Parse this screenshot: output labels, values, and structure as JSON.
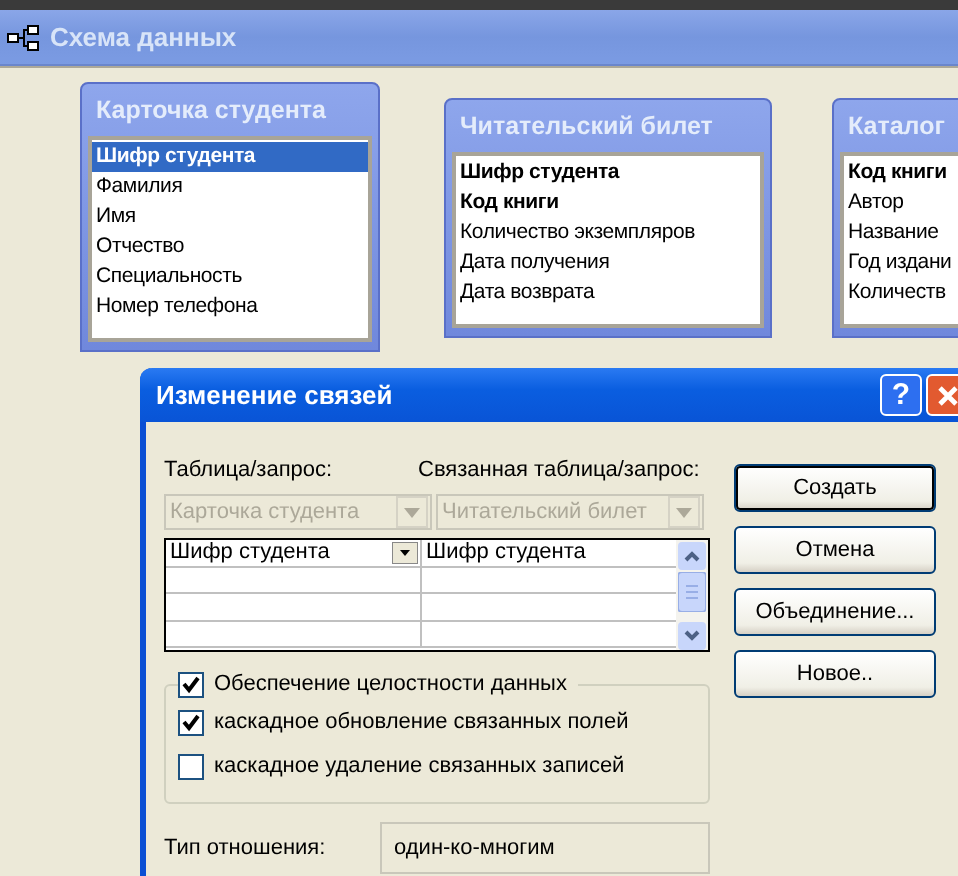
{
  "window": {
    "title": "Схема данных"
  },
  "tables": [
    {
      "title": "Карточка студента",
      "fields": [
        {
          "name": "Шифр студента",
          "key": true,
          "selected": true
        },
        {
          "name": "Фамилия",
          "key": false,
          "selected": false
        },
        {
          "name": "Имя",
          "key": false,
          "selected": false
        },
        {
          "name": "Отчество",
          "key": false,
          "selected": false
        },
        {
          "name": "Специальность",
          "key": false,
          "selected": false
        },
        {
          "name": "Номер телефона",
          "key": false,
          "selected": false
        }
      ]
    },
    {
      "title": "Читательский билет",
      "fields": [
        {
          "name": "Шифр студента",
          "key": true,
          "selected": false
        },
        {
          "name": "Код книги",
          "key": true,
          "selected": false
        },
        {
          "name": "Количество экземпляров",
          "key": false,
          "selected": false
        },
        {
          "name": "Дата получения",
          "key": false,
          "selected": false
        },
        {
          "name": "Дата возврата",
          "key": false,
          "selected": false
        }
      ]
    },
    {
      "title": "Каталог",
      "fields": [
        {
          "name": "Код книги",
          "key": true,
          "selected": false
        },
        {
          "name": "Автор",
          "key": false,
          "selected": false
        },
        {
          "name": "Название",
          "key": false,
          "selected": false
        },
        {
          "name": "Год издани",
          "key": false,
          "selected": false
        },
        {
          "name": "Количеств",
          "key": false,
          "selected": false
        }
      ]
    }
  ],
  "dialog": {
    "title": "Изменение связей",
    "help": "?",
    "table_label": "Таблица/запрос:",
    "related_label": "Связанная таблица/запрос:",
    "table_combo": {
      "value": "Карточка студента",
      "disabled": true
    },
    "related_combo": {
      "value": "Читательский билет",
      "disabled": true
    },
    "grid_rows": [
      {
        "left": "Шифр студента",
        "right": "Шифр студента"
      }
    ],
    "integrity": {
      "label": "Обеспечение целостности данных",
      "checked": true
    },
    "options": [
      {
        "label": "каскадное обновление связанных полей",
        "checked": true
      },
      {
        "label": "каскадное удаление связанных записей",
        "checked": false
      }
    ],
    "relation_label": "Тип отношения:",
    "relation_value": "один-ко-многим",
    "buttons": [
      "Создать",
      "Отмена",
      "Объединение...",
      "Новое.."
    ]
  }
}
